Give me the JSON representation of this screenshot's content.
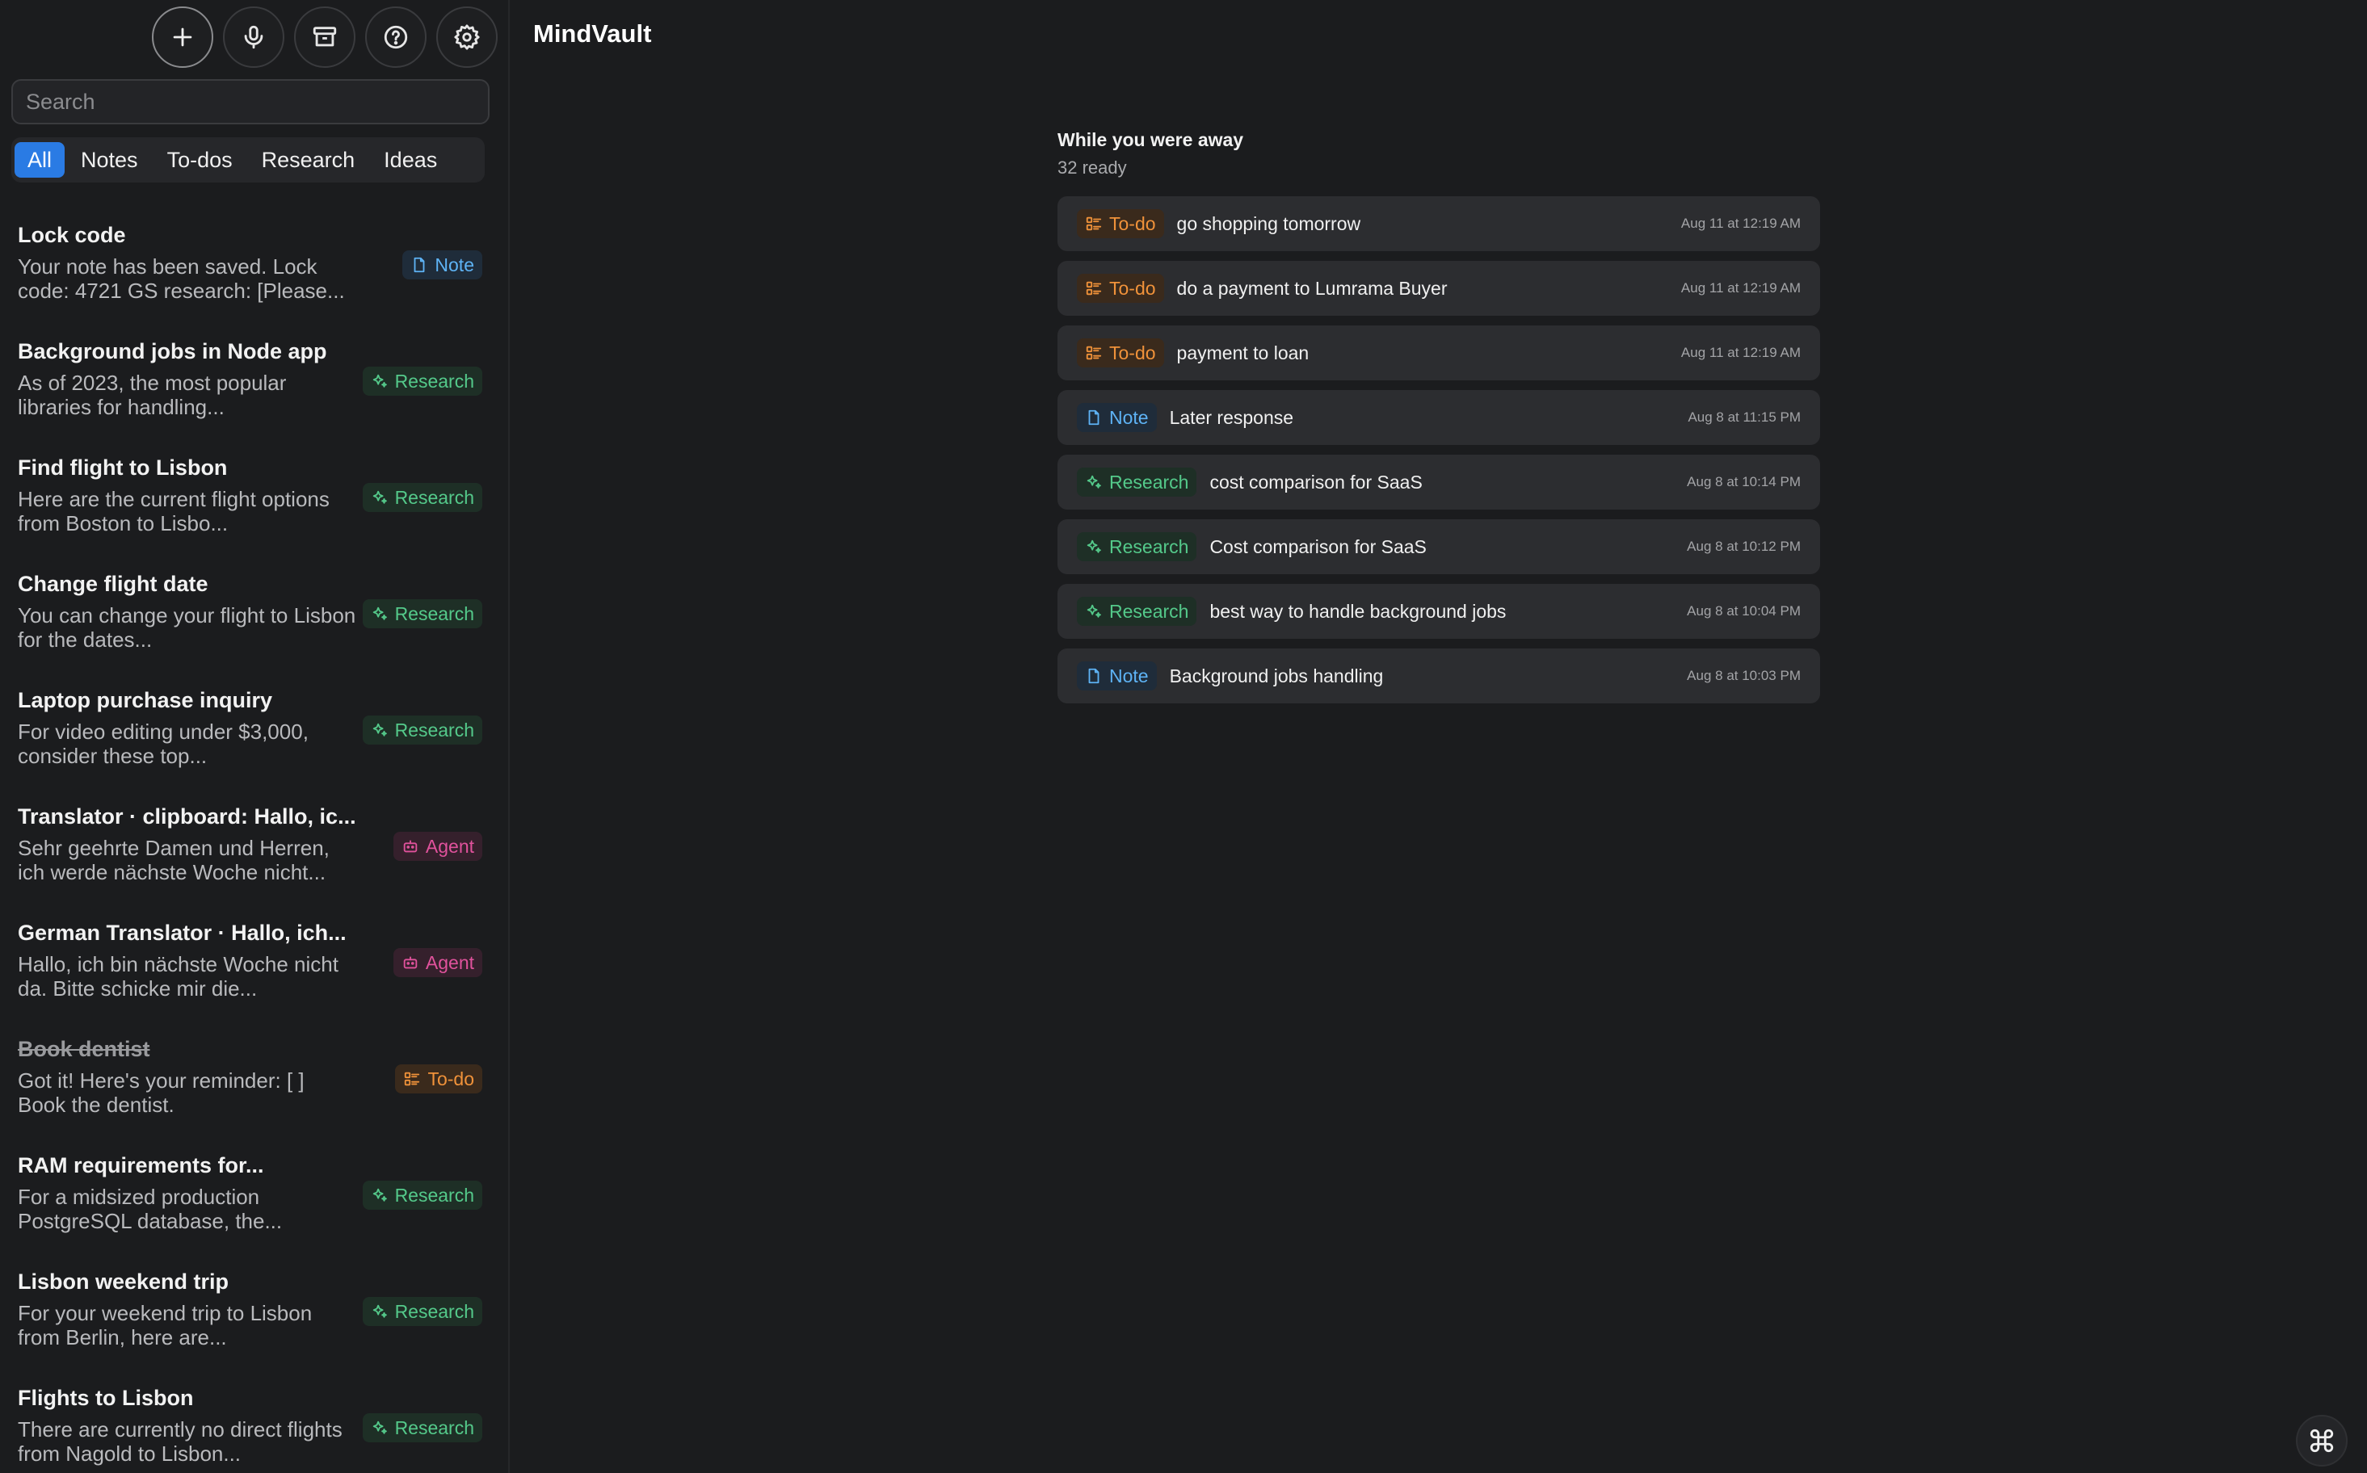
{
  "app_title": "MindVault",
  "toolbar": {
    "buttons": [
      {
        "icon": "plus-icon"
      },
      {
        "icon": "microphone-icon"
      },
      {
        "icon": "archive-icon"
      },
      {
        "icon": "help-icon"
      },
      {
        "icon": "gear-icon"
      }
    ]
  },
  "search": {
    "placeholder": "Search",
    "value": ""
  },
  "filters": [
    "All",
    "Notes",
    "To-dos",
    "Research",
    "Ideas"
  ],
  "active_filter": "All",
  "tags": {
    "note": "Note",
    "research": "Research",
    "todo": "To-do",
    "agent": "Agent"
  },
  "colors": {
    "accent": "#2a7be4",
    "note": "#5eb3f5",
    "research": "#54c98a",
    "todo": "#f0923a",
    "agent": "#e0529c",
    "background": "#1b1c1e",
    "row_bg": "#2c2d30"
  },
  "items": [
    {
      "title": "Lock code",
      "preview": "Your note has been saved. Lock code: 4721 GS research: [Please...",
      "tag": "Note",
      "kind": "note",
      "done": false
    },
    {
      "title": "Background jobs in Node app",
      "preview": "As of 2023, the most popular libraries for handling...",
      "tag": "Research",
      "kind": "research",
      "done": false
    },
    {
      "title": "Find flight to Lisbon",
      "preview": "Here are the current flight options from Boston to Lisbo...",
      "tag": "Research",
      "kind": "research",
      "done": false
    },
    {
      "title": "Change flight date",
      "preview": "You can change your flight to Lisbon for the dates...",
      "tag": "Research",
      "kind": "research",
      "done": false
    },
    {
      "title": "Laptop purchase inquiry",
      "preview": "For video editing under $3,000, consider these top...",
      "tag": "Research",
      "kind": "research",
      "done": false
    },
    {
      "title": "Translator · clipboard: Hallo,   ic...",
      "preview": "Sehr geehrte Damen und Herren, ich werde nächste Woche nicht...",
      "tag": "Agent",
      "kind": "agent",
      "done": false
    },
    {
      "title": "German Translator · Hallo,   ich...",
      "preview": "Hallo, ich bin nächste Woche nicht da. Bitte schicke mir die...",
      "tag": "Agent",
      "kind": "agent",
      "done": false
    },
    {
      "title": "Book dentist",
      "preview": "Got it! Here's your reminder: [ ] Book the dentist.",
      "tag": "To-do",
      "kind": "todo",
      "done": true
    },
    {
      "title": "RAM requirements for...",
      "preview": "For a midsized production PostgreSQL database, the...",
      "tag": "Research",
      "kind": "research",
      "done": false
    },
    {
      "title": "Lisbon weekend trip",
      "preview": "For your weekend trip to Lisbon from Berlin, here are...",
      "tag": "Research",
      "kind": "research",
      "done": false
    },
    {
      "title": "Flights to Lisbon",
      "preview": "There are currently no direct flights from Nagold to Lisbon...",
      "tag": "Research",
      "kind": "research",
      "done": false
    }
  ],
  "away": {
    "title": "While you were away",
    "subtitle": "32 ready",
    "rows": [
      {
        "tag": "To-do",
        "kind": "todo",
        "text": "go shopping tomorrow",
        "time": "Aug 11 at 12:19 AM"
      },
      {
        "tag": "To-do",
        "kind": "todo",
        "text": "do a payment to Lumrama Buyer",
        "time": "Aug 11 at 12:19 AM"
      },
      {
        "tag": "To-do",
        "kind": "todo",
        "text": "payment to loan",
        "time": "Aug 11 at 12:19 AM"
      },
      {
        "tag": "Note",
        "kind": "note",
        "text": "Later response",
        "time": "Aug 8 at 11:15 PM"
      },
      {
        "tag": "Research",
        "kind": "research",
        "text": "cost comparison for SaaS",
        "time": "Aug 8 at 10:14 PM"
      },
      {
        "tag": "Research",
        "kind": "research",
        "text": "Cost comparison for SaaS",
        "time": "Aug 8 at 10:12 PM"
      },
      {
        "tag": "Research",
        "kind": "research",
        "text": "best way to handle background jobs",
        "time": "Aug 8 at 10:04 PM"
      },
      {
        "tag": "Note",
        "kind": "note",
        "text": "Background jobs handling",
        "time": "Aug 8 at 10:03 PM"
      }
    ]
  },
  "corner_button": {
    "icon": "command-icon"
  }
}
